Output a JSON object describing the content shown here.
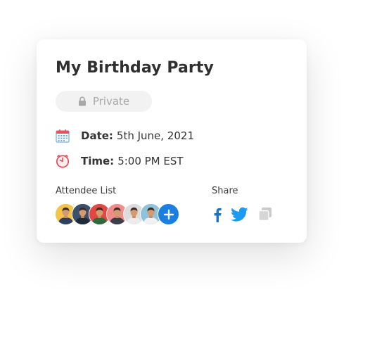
{
  "event": {
    "title": "My Birthday Party",
    "privacy_label": "Private",
    "date_label": "Date:",
    "date_value": "5th June, 2021",
    "time_label": "Time:",
    "time_value": "5:00 PM EST"
  },
  "attendees": {
    "label": "Attendee List",
    "avatars": [
      {
        "bg": "#f4c44a",
        "shirt": "#2f3f5f"
      },
      {
        "bg": "#3c4f6b",
        "shirt": "#1f2a3a"
      },
      {
        "bg": "#e14842",
        "shirt": "#2d6b3f"
      },
      {
        "bg": "#f08d8a",
        "shirt": "#3a3f4a"
      },
      {
        "bg": "#dcdcdc",
        "shirt": "#ececec"
      },
      {
        "bg": "#8fc3dc",
        "shirt": "#f1f1f1"
      }
    ]
  },
  "share": {
    "label": "Share",
    "icons": [
      "facebook-icon",
      "twitter-icon",
      "copy-link-icon"
    ]
  },
  "colors": {
    "accent_blue": "#1a7fe0",
    "facebook": "#1f72c9",
    "twitter": "#1d9bf0",
    "calendar_red": "#e8545a",
    "calendar_blue": "#6aaee8",
    "clock_red": "#e0434d"
  }
}
